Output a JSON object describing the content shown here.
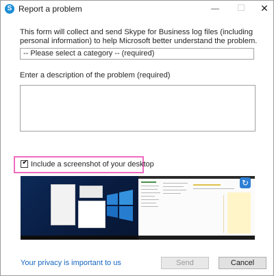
{
  "window": {
    "title": "Report a problem",
    "app_icon_glyph": "S",
    "app_icon": "skype-icon",
    "controls": {
      "minimize_glyph": "—",
      "maximize_glyph": "☐",
      "close_glyph": "✕"
    }
  },
  "form": {
    "intro_text": "This form will collect and send Skype for Business log files (including personal information) to help Microsoft better understand the problem.",
    "category_select": {
      "selected": "-- Please select a category -- (required)"
    },
    "description": {
      "label": "Enter a description of the problem (required)",
      "value": ""
    },
    "screenshot_checkbox": {
      "checked": true,
      "check_glyph": "✔",
      "label": "Include a screenshot of your desktop"
    },
    "screenshot_preview": {
      "refresh_icon": "sync-icon",
      "refresh_glyph": "↻"
    }
  },
  "footer": {
    "privacy_link": "Your privacy is important to us",
    "send_label": "Send",
    "cancel_label": "Cancel"
  },
  "colors": {
    "highlight": "#f06abf",
    "link": "#1565c0",
    "skype_blue": "#1d8fd6"
  }
}
